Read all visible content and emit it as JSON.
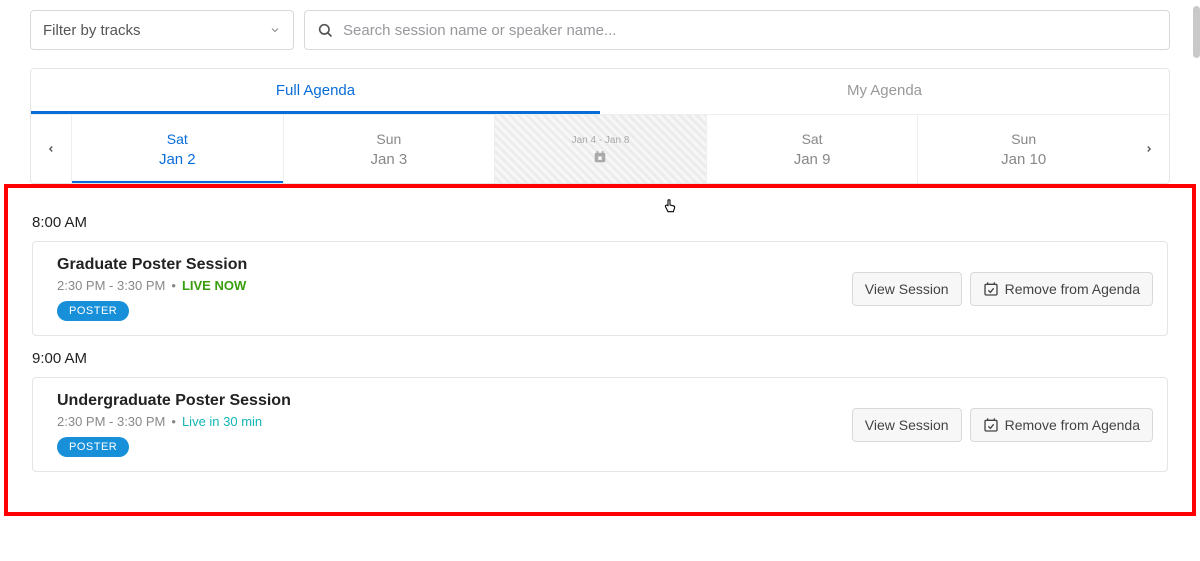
{
  "filter": {
    "label": "Filter by tracks"
  },
  "search": {
    "placeholder": "Search session name or speaker name..."
  },
  "tabs": {
    "full": "Full Agenda",
    "my": "My Agenda"
  },
  "dates": {
    "items": [
      {
        "dow": "Sat",
        "date": "Jan 2",
        "active": true
      },
      {
        "dow": "Sun",
        "date": "Jan 3",
        "active": false
      },
      {
        "range": "Jan 4 - Jan 8",
        "skip": true
      },
      {
        "dow": "Sat",
        "date": "Jan 9",
        "active": false
      },
      {
        "dow": "Sun",
        "date": "Jan 10",
        "active": false
      }
    ]
  },
  "timeSlots": [
    {
      "header": "8:00 AM",
      "session": {
        "title": "Graduate Poster Session",
        "time": "2:30 PM - 3:30 PM",
        "liveLabel": "LIVE NOW",
        "liveClass": "live-now",
        "tag": "POSTER"
      }
    },
    {
      "header": "9:00 AM",
      "session": {
        "title": "Undergraduate Poster Session",
        "time": "2:30 PM - 3:30 PM",
        "liveLabel": "Live in 30 min",
        "liveClass": "live-soon",
        "tag": "POSTER"
      }
    }
  ],
  "buttons": {
    "view": "View Session",
    "remove": "Remove from Agenda"
  }
}
